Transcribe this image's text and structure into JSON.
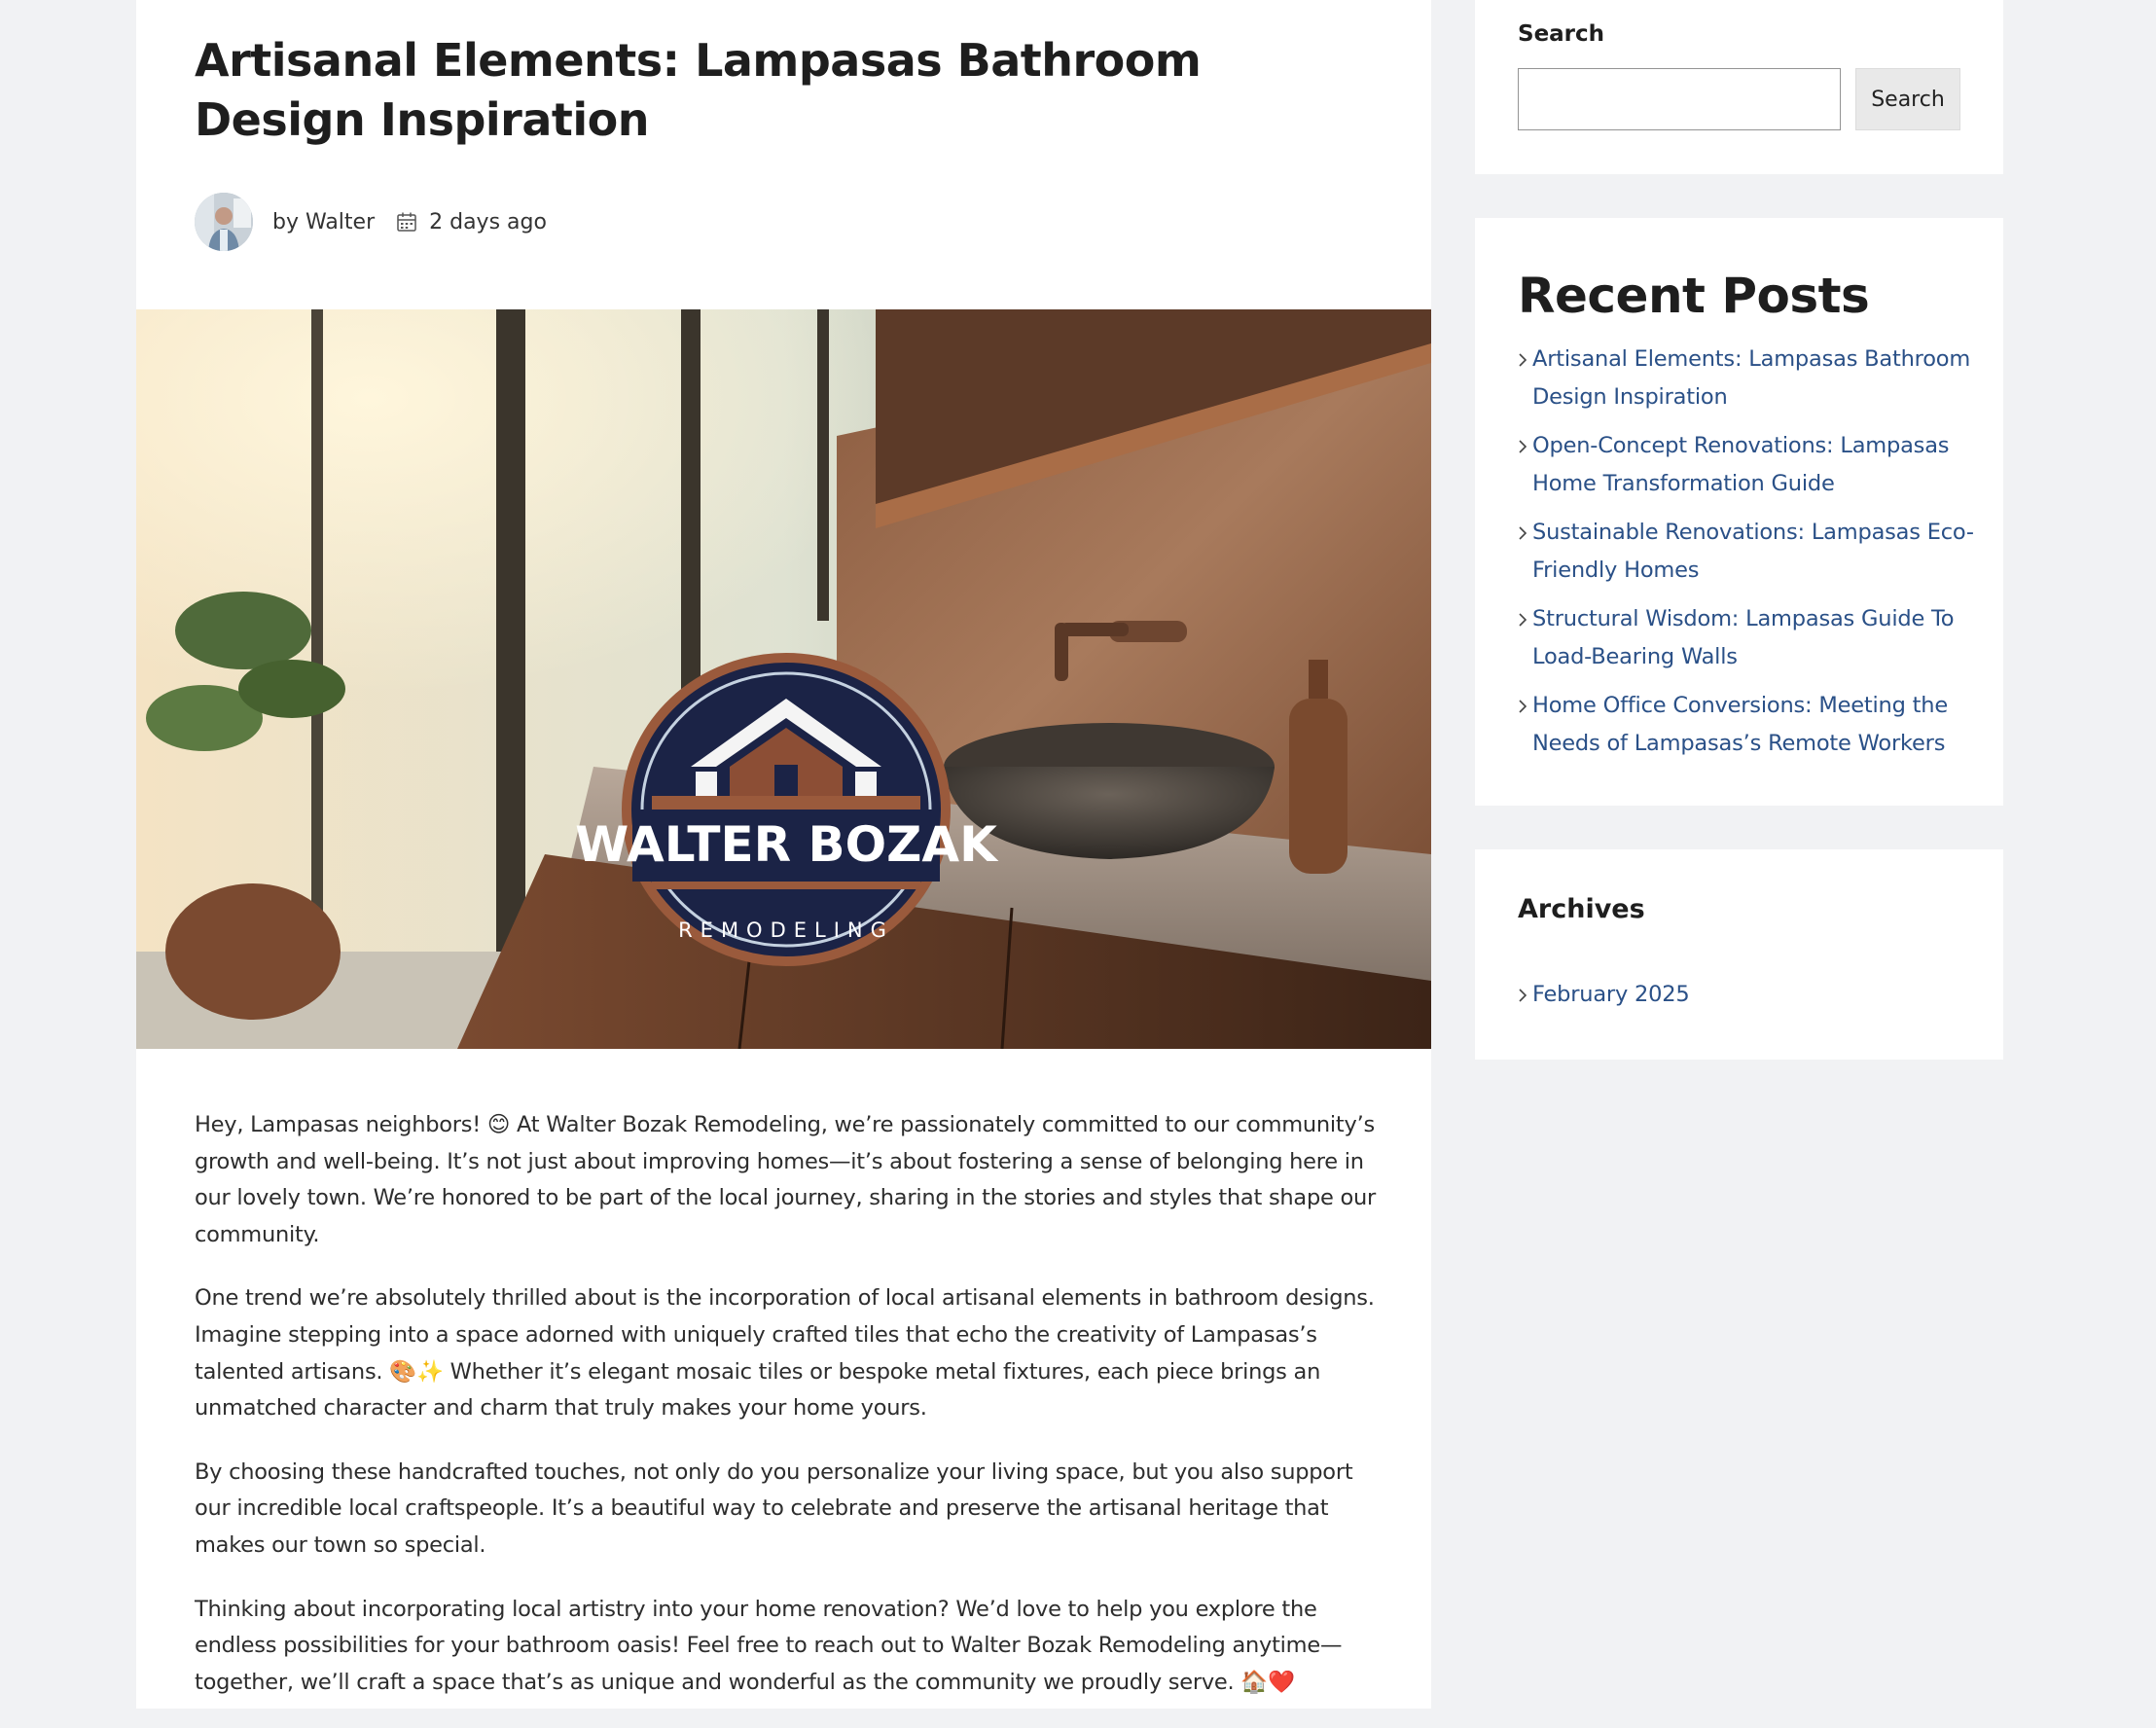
{
  "post": {
    "title": "Artisanal Elements: Lampasas Bathroom Design Inspiration",
    "author": "by Walter",
    "date": "2 days ago",
    "hero_logo": {
      "name": "WALTER BOZAK",
      "tagline": "REMODELING"
    },
    "paragraphs": [
      "Hey, Lampasas neighbors! 😊 At Walter Bozak Remodeling, we’re passionately committed to our community’s growth and well-being. It’s not just about improving homes—it’s about fostering a sense of belonging here in our lovely town. We’re honored to be part of the local journey, sharing in the stories and styles that shape our community.",
      "One trend we’re absolutely thrilled about is the incorporation of local artisanal elements in bathroom designs. Imagine stepping into a space adorned with uniquely crafted tiles that echo the creativity of Lampasas’s talented artisans. 🎨✨ Whether it’s elegant mosaic tiles or bespoke metal fixtures, each piece brings an unmatched character and charm that truly makes your home yours.",
      "By choosing these handcrafted touches, not only do you personalize your living space, but you also support our incredible local craftspeople. It’s a beautiful way to celebrate and preserve the artisanal heritage that makes our town so special.",
      "Thinking about incorporating local artistry into your home renovation? We’d love to help you explore the endless possibilities for your bathroom oasis! Feel free to reach out to Walter Bozak Remodeling anytime—together, we’ll craft a space that’s as unique and wonderful as the community we proudly serve. 🏠❤️"
    ]
  },
  "sidebar": {
    "search": {
      "label": "Search",
      "placeholder": "",
      "value": "",
      "button_label": "Search"
    },
    "recent_posts": {
      "title": "Recent Posts",
      "items": [
        "Artisanal Elements: Lampasas Bathroom Design Inspiration",
        "Open-Concept Renovations: Lampasas Home Transformation Guide",
        "Sustainable Renovations: Lampasas Eco-Friendly Homes",
        "Structural Wisdom: Lampasas Guide To Load-Bearing Walls",
        "Home Office Conversions: Meeting the Needs of Lampasas’s Remote Workers"
      ]
    },
    "archives": {
      "title": "Archives",
      "items": [
        "February 2025"
      ]
    }
  },
  "colors": {
    "background": "#f1f2f4",
    "card": "#ffffff",
    "link": "#2a5087",
    "text": "#222222",
    "logo_navy": "#1b2346",
    "logo_copper": "#9a5a3c"
  },
  "icons": {
    "avatar": "avatar-photo",
    "date": "calendar-icon",
    "list_marker": "chevron-right-icon"
  }
}
